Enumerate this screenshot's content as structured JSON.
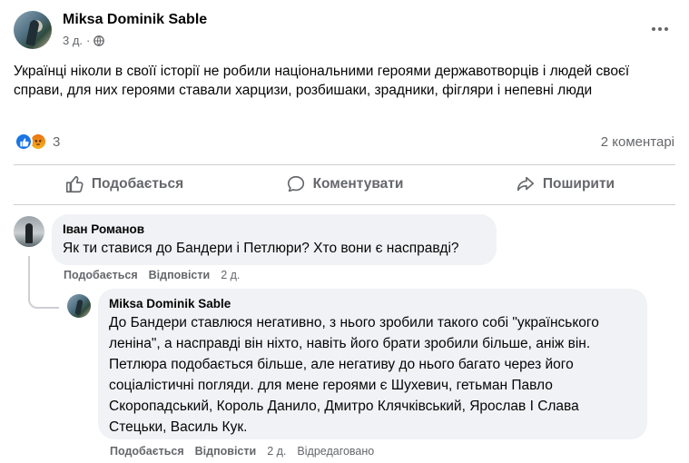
{
  "post": {
    "author": "Miksa Dominik Sable",
    "time": "3 д.",
    "privacy_icon": "globe-icon",
    "text": "Українці ніколи в своїї історії не робили  національними героями державотворців і людей своєї справи, для них героями ставали харцизи, розбишаки, зрадники, фігляри і непевні люди",
    "reactions": {
      "count": "3",
      "types": [
        "like",
        "angry"
      ]
    },
    "comments_count": "2 коментарі"
  },
  "actions": {
    "like": "Подобається",
    "comment": "Коментувати",
    "share": "Поширити"
  },
  "comments": [
    {
      "author": "Іван Романов",
      "text": "Як ти ставися до Бандери і Петлюри? Хто вони є насправді?",
      "like_label": "Подобається",
      "reply_label": "Відповісти",
      "time": "2 д."
    },
    {
      "author": "Miksa Dominik Sable",
      "text": "До Бандери ставлюся негативно, з нього зробили такого собі \"українського леніна\", а насправді він ніхто, навіть його брати зробили більше, аніж він. Петлюра подобається більше, але негативу до нього багато через його соціалістичні погляди. для мене героями є Шухевич, гетьман Павло Скоропадський, Король Данило, Дмитро Клячківський, Ярослав І Слава Стецьки, Василь Кук.",
      "like_label": "Подобається",
      "reply_label": "Відповісти",
      "time": "2 д.",
      "edited": "Відредаговано"
    }
  ],
  "colors": {
    "like_blue": "#1b74e4",
    "secondary_text": "#65676b",
    "bubble_bg": "#f0f2f5"
  }
}
